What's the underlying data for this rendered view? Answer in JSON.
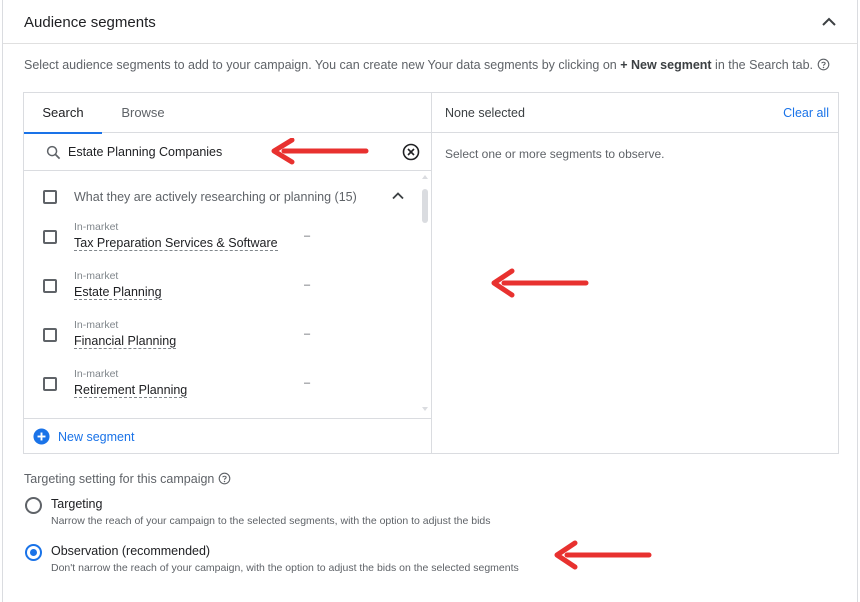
{
  "section": {
    "title": "Audience segments",
    "description_pre": "Select audience segments to add to your campaign. You can create new Your data segments by clicking on ",
    "description_bold": "+ New segment",
    "description_post": " in the Search tab."
  },
  "tabs": [
    {
      "label": "Search",
      "active": true
    },
    {
      "label": "Browse",
      "active": false
    }
  ],
  "search": {
    "value": "Estate Planning Companies"
  },
  "group": {
    "label": "What they are actively researching or planning (15)",
    "checked": false,
    "expanded": true
  },
  "segments": [
    {
      "category": "In-market",
      "name": "Tax Preparation Services & Software",
      "reach": "–",
      "checked": false
    },
    {
      "category": "In-market",
      "name": "Estate Planning",
      "reach": "–",
      "checked": false
    },
    {
      "category": "In-market",
      "name": "Financial Planning",
      "reach": "–",
      "checked": false
    },
    {
      "category": "In-market",
      "name": "Retirement Planning",
      "reach": "–",
      "checked": false
    }
  ],
  "new_segment_label": "New segment",
  "selected_panel": {
    "status": "None selected",
    "clear_all": "Clear all",
    "hint": "Select one or more segments to observe."
  },
  "targeting_setting": {
    "label": "Targeting setting for this campaign",
    "options": [
      {
        "label": "Targeting",
        "description": "Narrow the reach of your campaign to the selected segments, with the option to adjust the bids",
        "selected": false
      },
      {
        "label": "Observation (recommended)",
        "description": "Don't narrow the reach of your campaign, with the option to adjust the bids on the selected segments",
        "selected": true
      }
    ]
  },
  "colors": {
    "accent": "#1a73e8",
    "annotation_arrow": "#e8312f"
  },
  "icons": {
    "collapse": "chevron-up-icon",
    "help": "help-circle-icon",
    "search": "search-icon",
    "clear": "clear-circle-icon",
    "add": "add-circle-icon",
    "annotation": "red-arrow-icon"
  }
}
